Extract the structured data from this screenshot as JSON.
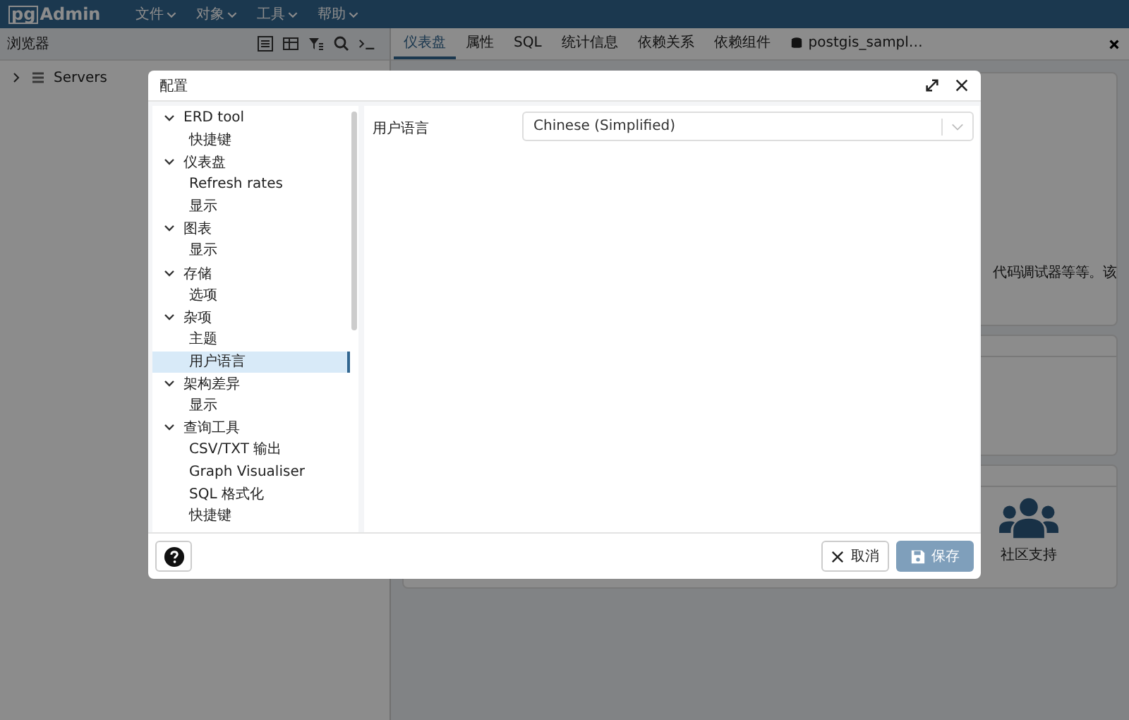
{
  "navbar": {
    "logo_box": "pg",
    "logo_text": "Admin",
    "menus": [
      "文件",
      "对象",
      "工具",
      "帮助"
    ]
  },
  "browser": {
    "title": "浏览器",
    "tree": [
      {
        "label": "Servers",
        "expanded": false
      }
    ]
  },
  "tabs": [
    {
      "label": "仪表盘",
      "selected": true,
      "kind": "text"
    },
    {
      "label": "属性",
      "selected": false,
      "kind": "text"
    },
    {
      "label": "SQL",
      "selected": false,
      "kind": "text"
    },
    {
      "label": "统计信息",
      "selected": false,
      "kind": "text"
    },
    {
      "label": "依赖关系",
      "selected": false,
      "kind": "text"
    },
    {
      "label": "依赖组件",
      "selected": false,
      "kind": "text"
    },
    {
      "label": "postgis_sampl…",
      "selected": false,
      "kind": "query"
    }
  ],
  "dashboard": {
    "description_fragment": "代码调试器等等。该",
    "community_label": "社区支持"
  },
  "dialog": {
    "title": "配置",
    "tree": [
      {
        "label": "ERD tool",
        "expanded": true,
        "children": [
          {
            "label": "快捷键",
            "selected": false
          }
        ]
      },
      {
        "label": "仪表盘",
        "expanded": true,
        "children": [
          {
            "label": "Refresh rates",
            "selected": false
          },
          {
            "label": "显示",
            "selected": false
          }
        ]
      },
      {
        "label": "图表",
        "expanded": true,
        "children": [
          {
            "label": "显示",
            "selected": false
          }
        ]
      },
      {
        "label": "存储",
        "expanded": true,
        "children": [
          {
            "label": "选项",
            "selected": false
          }
        ]
      },
      {
        "label": "杂项",
        "expanded": true,
        "children": [
          {
            "label": "主题",
            "selected": false
          },
          {
            "label": "用户语言",
            "selected": true
          }
        ]
      },
      {
        "label": "架构差异",
        "expanded": true,
        "children": [
          {
            "label": "显示",
            "selected": false
          }
        ]
      },
      {
        "label": "查询工具",
        "expanded": true,
        "children": [
          {
            "label": "CSV/TXT 输出",
            "selected": false
          },
          {
            "label": "Graph Visualiser",
            "selected": false
          },
          {
            "label": "SQL 格式化",
            "selected": false
          },
          {
            "label": "快捷键",
            "selected": false
          }
        ]
      }
    ],
    "field": {
      "label": "用户语言",
      "value": "Chinese (Simplified)"
    },
    "cancel": "取消",
    "save": "保存",
    "save_disabled": true
  }
}
